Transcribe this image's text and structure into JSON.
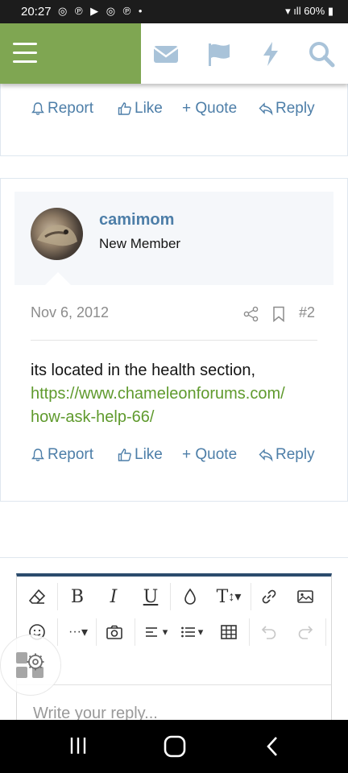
{
  "status": {
    "time": "20:27",
    "notifications": "◎ ℗ ▶ ◎ ℗  •",
    "battery": "60%"
  },
  "icons": {
    "menu": "hamburger-menu-icon",
    "inbox": "envelope-icon",
    "alerts": "flag-icon",
    "whats_new": "lightning-icon",
    "search": "search-icon"
  },
  "colors": {
    "accent_green": "#7fa652",
    "link_blue": "#4d7ea8",
    "url_green": "#5f9a2d",
    "editor_border": "#2b4b6d"
  },
  "top_post_actions": {
    "report": "Report",
    "like": "Like",
    "quote": "+ Quote",
    "reply": "Reply"
  },
  "post": {
    "username": "camimom",
    "user_title": "New Member",
    "date": "Nov 6, 2012",
    "number": "#2",
    "text": "its located in the health section,",
    "link": "https://www.chameleonforums.com/how-ask-help-66/",
    "link_display_line1": "https://www.chameleonforums.com/",
    "link_display_line2": "how-ask-help-66/",
    "actions": {
      "report": "Report",
      "like": "Like",
      "quote": "+ Quote",
      "reply": "Reply"
    }
  },
  "editor": {
    "bold": "B",
    "italic": "I",
    "underline": "U",
    "text_size": "T",
    "more": "···",
    "placeholder": "Write your reply..."
  }
}
